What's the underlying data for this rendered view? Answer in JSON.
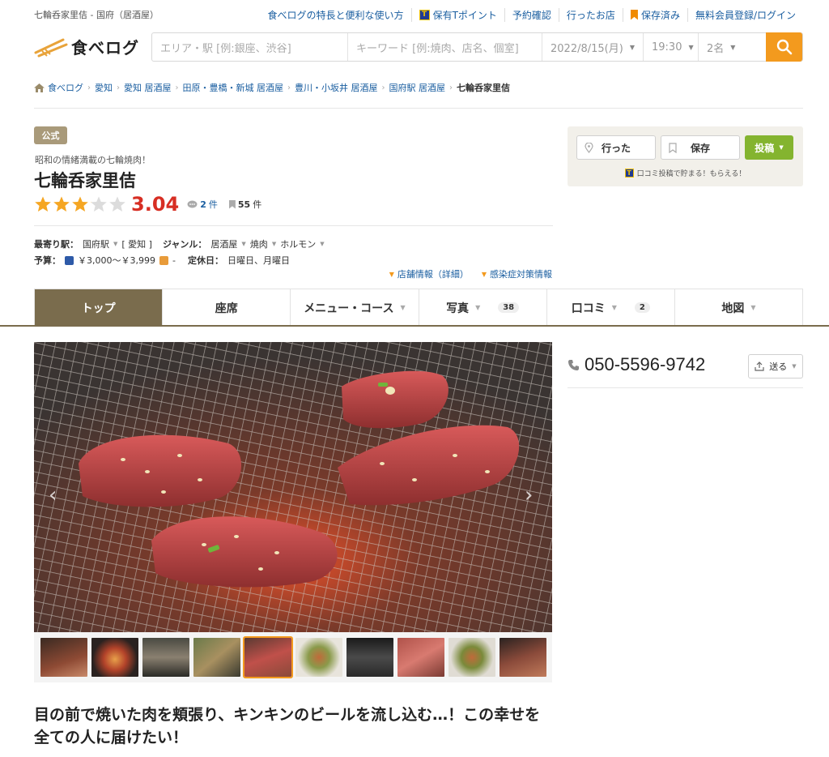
{
  "top": {
    "site_title": "七輪呑家里佶 - 国府（居酒屋）",
    "links": [
      "食べログの特長と便利な使い方",
      "保有Tポイント",
      "予約確認",
      "行ったお店",
      "保存済み",
      "無料会員登録/ログイン"
    ]
  },
  "logo": {
    "text": "食べログ"
  },
  "search": {
    "area_placeholder": "エリア・駅 [例:銀座、渋谷]",
    "keyword_placeholder": "キーワード [例:焼肉、店名、個室]",
    "date": "2022/8/15(月)",
    "time": "19:30",
    "people": "2名"
  },
  "breadcrumb": [
    "食べログ",
    "愛知",
    "愛知 居酒屋",
    "田原・豊橋・新城 居酒屋",
    "豊川・小坂井 居酒屋",
    "国府駅 居酒屋",
    "七輪呑家里佶"
  ],
  "shop": {
    "badge": "公式",
    "catchphrase": "昭和の情緒満載の七輪焼肉！",
    "name": "七輪呑家里佶",
    "rating": 3.04,
    "rating_text": "3.04",
    "review_count": "2",
    "review_unit": "件",
    "save_count": "55",
    "save_unit": "件",
    "station_label": "最寄り駅：",
    "station": "国府駅",
    "pref": "[ 愛知 ]",
    "genre_label": "ジャンル：",
    "genres": [
      "居酒屋",
      "焼肉",
      "ホルモン"
    ],
    "budget_label": "予算：",
    "budget_dinner": "￥3,000～￥3,999",
    "budget_lunch": "-",
    "holiday_label": "定休日：",
    "holiday": "日曜日、月曜日"
  },
  "info_links": [
    "店舗情報（詳細）",
    "感染症対策情報"
  ],
  "actions": {
    "went": "行った",
    "save": "保存",
    "post": "投稿",
    "promo": "口コミ投稿で貯まる！もらえる！"
  },
  "tabs": [
    {
      "label": "トップ",
      "count": ""
    },
    {
      "label": "座席",
      "count": ""
    },
    {
      "label": "メニュー・コース",
      "count": ""
    },
    {
      "label": "写真",
      "count": "38"
    },
    {
      "label": "口コミ",
      "count": "2"
    },
    {
      "label": "地図",
      "count": ""
    }
  ],
  "contact": {
    "phone": "050-5596-9742",
    "send": "送る"
  },
  "headline": "目の前で焼いた肉を頬張り、キンキンのビールを流し込む…！この幸せを全ての人に届けたい！",
  "colors": {
    "accent": "#f39a1e",
    "tab_active": "#7a6c4d",
    "score": "#d72e23",
    "link": "#1a5ea0",
    "post": "#84b42f"
  }
}
